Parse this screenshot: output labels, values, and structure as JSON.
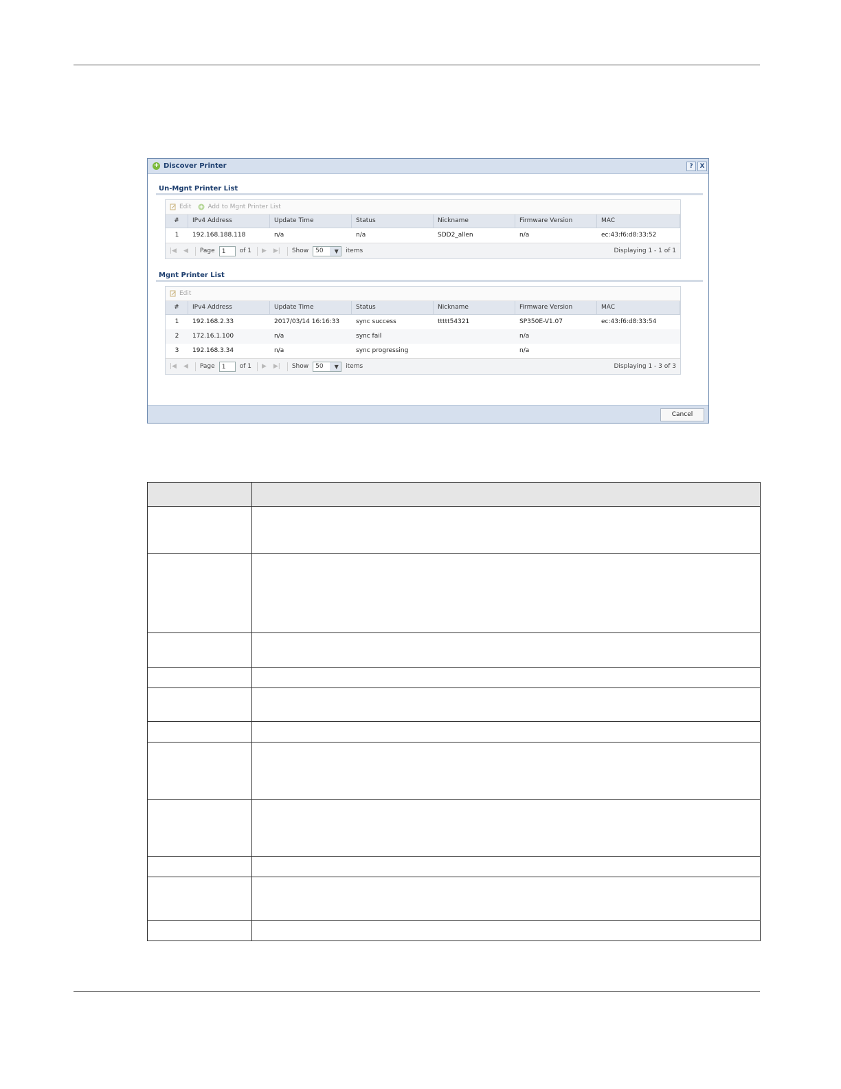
{
  "dialog": {
    "title": "Discover Printer",
    "help_label": "?",
    "close_label": "X",
    "unmgnt": {
      "title": "Un-Mgnt Printer List",
      "toolbar": {
        "edit": "Edit",
        "add": "Add to Mgnt Printer List"
      },
      "columns": [
        "#",
        "IPv4 Address",
        "Update Time",
        "Status",
        "Nickname",
        "Firmware Version",
        "MAC"
      ],
      "rows": [
        [
          "1",
          "192.168.188.118",
          "n/a",
          "n/a",
          "SDD2_allen",
          "n/a",
          "ec:43:f6:d8:33:52"
        ]
      ],
      "pager": {
        "page_label": "Page",
        "page_value": "1",
        "of_label": "of 1",
        "show_label": "Show",
        "show_value": "50",
        "items_label": "items",
        "displaying": "Displaying 1 - 1 of 1"
      }
    },
    "mgnt": {
      "title": "Mgnt Printer List",
      "toolbar": {
        "edit": "Edit"
      },
      "columns": [
        "#",
        "IPv4 Address",
        "Update Time",
        "Status",
        "Nickname",
        "Firmware Version",
        "MAC"
      ],
      "rows": [
        [
          "1",
          "192.168.2.33",
          "2017/03/14 16:16:33",
          "sync success",
          "ttttt54321",
          "SP350E-V1.07",
          "ec:43:f6:d8:33:54"
        ],
        [
          "2",
          "172.16.1.100",
          "n/a",
          "sync fail",
          "",
          "n/a",
          ""
        ],
        [
          "3",
          "192.168.3.34",
          "n/a",
          "sync progressing",
          "",
          "n/a",
          ""
        ]
      ],
      "pager": {
        "page_label": "Page",
        "page_value": "1",
        "of_label": "of 1",
        "show_label": "Show",
        "show_value": "50",
        "items_label": "items",
        "displaying": "Displaying 1 - 3 of 3"
      }
    },
    "cancel_label": "Cancel"
  }
}
